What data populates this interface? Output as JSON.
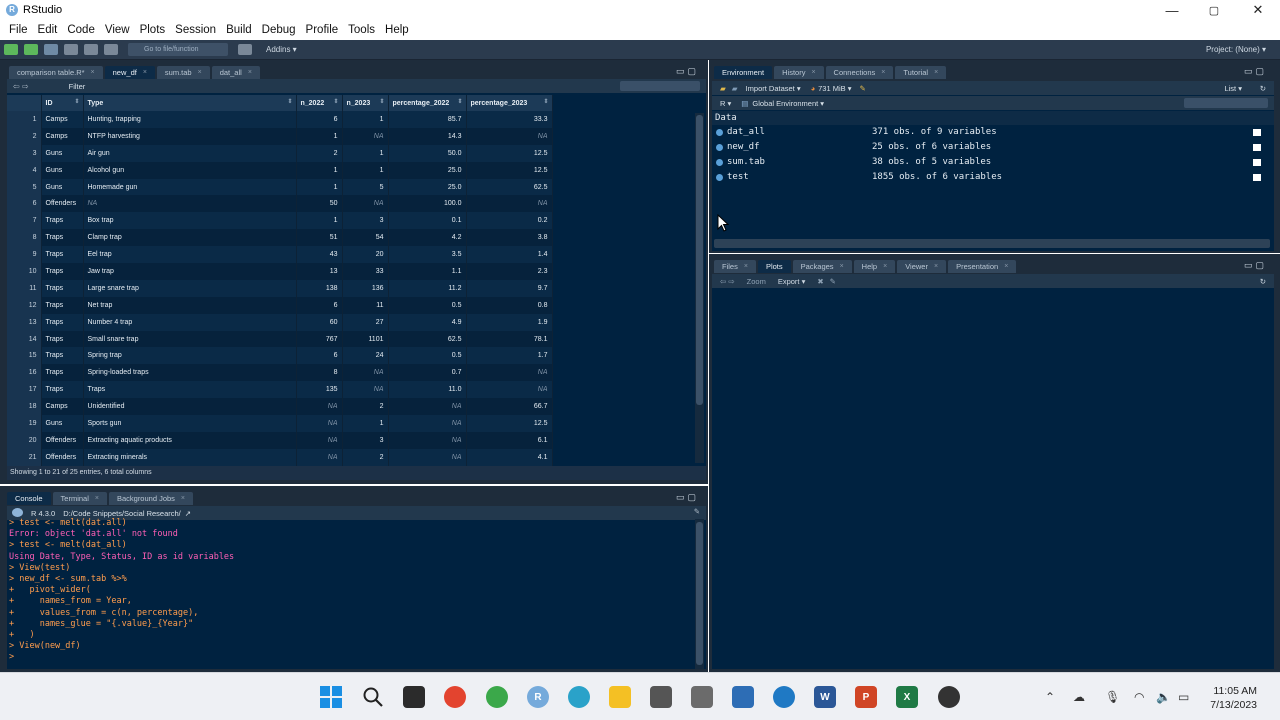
{
  "window": {
    "title": "RStudio",
    "minimize": "—",
    "maximize": "▢",
    "close": "✕"
  },
  "menu": [
    "File",
    "Edit",
    "Code",
    "View",
    "Plots",
    "Session",
    "Build",
    "Debug",
    "Profile",
    "Tools",
    "Help"
  ],
  "toolbar": {
    "goto_placeholder": "Go to file/function",
    "addins": "Addins ▾",
    "project": "Project: (None) ▾"
  },
  "source": {
    "tabs": [
      {
        "label": "comparison table.R*",
        "active": false
      },
      {
        "label": "new_df",
        "active": true
      },
      {
        "label": "sum.tab",
        "active": false
      },
      {
        "label": "dat_all",
        "active": false
      }
    ],
    "filter_label": "Filter",
    "columns": [
      "ID",
      "Type",
      "n_2022",
      "n_2023",
      "percentage_2022",
      "percentage_2023"
    ],
    "rows": [
      [
        "1",
        "Camps",
        "Hunting, trapping",
        "6",
        "1",
        "85.7",
        "33.3"
      ],
      [
        "2",
        "Camps",
        "NTFP harvesting",
        "1",
        "NA",
        "14.3",
        "NA"
      ],
      [
        "3",
        "Guns",
        "Air gun",
        "2",
        "1",
        "50.0",
        "12.5"
      ],
      [
        "4",
        "Guns",
        "Alcohol gun",
        "1",
        "1",
        "25.0",
        "12.5"
      ],
      [
        "5",
        "Guns",
        "Homemade gun",
        "1",
        "5",
        "25.0",
        "62.5"
      ],
      [
        "6",
        "Offenders",
        "NA",
        "50",
        "NA",
        "100.0",
        "NA"
      ],
      [
        "7",
        "Traps",
        "Box trap",
        "1",
        "3",
        "0.1",
        "0.2"
      ],
      [
        "8",
        "Traps",
        "Clamp trap",
        "51",
        "54",
        "4.2",
        "3.8"
      ],
      [
        "9",
        "Traps",
        "Eel trap",
        "43",
        "20",
        "3.5",
        "1.4"
      ],
      [
        "10",
        "Traps",
        "Jaw trap",
        "13",
        "33",
        "1.1",
        "2.3"
      ],
      [
        "11",
        "Traps",
        "Large snare trap",
        "138",
        "136",
        "11.2",
        "9.7"
      ],
      [
        "12",
        "Traps",
        "Net trap",
        "6",
        "11",
        "0.5",
        "0.8"
      ],
      [
        "13",
        "Traps",
        "Number 4 trap",
        "60",
        "27",
        "4.9",
        "1.9"
      ],
      [
        "14",
        "Traps",
        "Small snare trap",
        "767",
        "1101",
        "62.5",
        "78.1"
      ],
      [
        "15",
        "Traps",
        "Spring trap",
        "6",
        "24",
        "0.5",
        "1.7"
      ],
      [
        "16",
        "Traps",
        "Spring-loaded traps",
        "8",
        "NA",
        "0.7",
        "NA"
      ],
      [
        "17",
        "Traps",
        "Traps",
        "135",
        "NA",
        "11.0",
        "NA"
      ],
      [
        "18",
        "Camps",
        "Unidentified",
        "NA",
        "2",
        "NA",
        "66.7"
      ],
      [
        "19",
        "Guns",
        "Sports gun",
        "NA",
        "1",
        "NA",
        "12.5"
      ],
      [
        "20",
        "Offenders",
        "Extracting aquatic products",
        "NA",
        "3",
        "NA",
        "6.1"
      ],
      [
        "21",
        "Offenders",
        "Extracting minerals",
        "NA",
        "2",
        "NA",
        "4.1"
      ]
    ],
    "footer": "Showing 1 to 21 of 25 entries, 6 total columns"
  },
  "console": {
    "tabs": [
      {
        "label": "Console",
        "active": true
      },
      {
        "label": "Terminal",
        "active": false
      },
      {
        "label": "Background Jobs",
        "active": false
      }
    ],
    "r_version": "R 4.3.0",
    "path": "D:/Code Snippets/Social Research/",
    "lines": [
      {
        "kind": "cmd",
        "text": "> test <- melt(dat.all)"
      },
      {
        "kind": "err",
        "text": "Error: object 'dat.all' not found"
      },
      {
        "kind": "cmd",
        "text": "> test <- melt(dat_all)"
      },
      {
        "kind": "err",
        "text": "Using Date, Type, Status, ID as id variables"
      },
      {
        "kind": "cmd",
        "text": "> View(test)"
      },
      {
        "kind": "cmd",
        "text": "> new_df <- sum.tab %>%"
      },
      {
        "kind": "cmd",
        "text": "+   pivot_wider("
      },
      {
        "kind": "cmd",
        "text": "+     names_from = Year,"
      },
      {
        "kind": "cmd",
        "text": "+     values_from = c(n, percentage),"
      },
      {
        "kind": "cmd",
        "text": "+     names_glue = \"{.value}_{Year}\""
      },
      {
        "kind": "cmd",
        "text": "+   )"
      },
      {
        "kind": "cmd",
        "text": "> View(new_df)"
      },
      {
        "kind": "cmd",
        "text": "> "
      }
    ]
  },
  "environment": {
    "tabs": [
      {
        "label": "Environment",
        "active": true
      },
      {
        "label": "History",
        "active": false
      },
      {
        "label": "Connections",
        "active": false
      },
      {
        "label": "Tutorial",
        "active": false
      }
    ],
    "import_label": "Import Dataset ▾",
    "memory": "731 MiB ▾",
    "list_label": "List ▾",
    "lang": "R ▾",
    "scope": "Global Environment ▾",
    "section": "Data",
    "objects": [
      {
        "name": "dat_all",
        "desc": "371 obs. of 9 variables"
      },
      {
        "name": "new_df",
        "desc": "25 obs. of 6 variables"
      },
      {
        "name": "sum.tab",
        "desc": "38 obs. of 5 variables"
      },
      {
        "name": "test",
        "desc": "1855 obs. of 6 variables"
      }
    ]
  },
  "files": {
    "tabs": [
      {
        "label": "Files",
        "active": false
      },
      {
        "label": "Plots",
        "active": true
      },
      {
        "label": "Packages",
        "active": false
      },
      {
        "label": "Help",
        "active": false
      },
      {
        "label": "Viewer",
        "active": false
      },
      {
        "label": "Presentation",
        "active": false
      }
    ],
    "zoom_label": "Zoom",
    "export_label": "Export ▾"
  },
  "taskbar": {
    "time": "11:05 AM",
    "date": "7/13/2023"
  },
  "colors": {
    "pane_bg": "#002240",
    "command": "#ff9d4d",
    "error": "#ff5fb5"
  }
}
